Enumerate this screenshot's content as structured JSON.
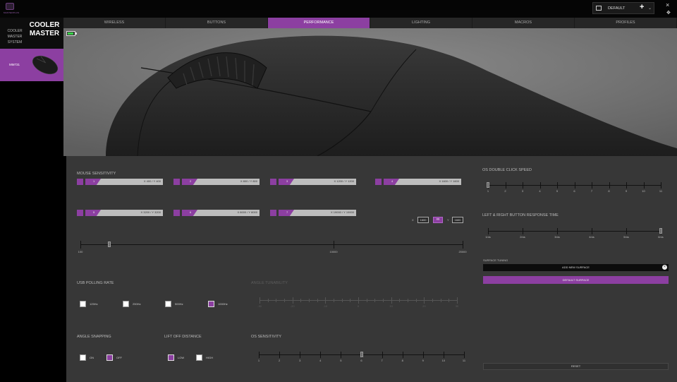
{
  "app": {
    "logo_text": "MASTERPLUS"
  },
  "profile": {
    "name": "DEFAULT",
    "add": "+",
    "chevron": "⌄"
  },
  "window": {
    "close": "×",
    "move": "✥"
  },
  "sidebar": {
    "system_label": "COOLER MASTER SYSTEM",
    "logo_lines": [
      "COOLER",
      "MASTER"
    ],
    "device_name": "MM731"
  },
  "tabs": [
    "WIRELESS",
    "BUTTONS",
    "PERFORMANCE",
    "LIGHTING",
    "MACROS",
    "PROFILES"
  ],
  "active_tab": "PERFORMANCE",
  "battery": {
    "level": 0.7,
    "color": "#39d24a"
  },
  "sensitivity": {
    "title": "MOUSE SENSITIVITY",
    "stages": [
      {
        "n": "1",
        "value": "X 400 / Y 400",
        "enabled": true
      },
      {
        "n": "2",
        "value": "X 800 / Y 800",
        "enabled": true
      },
      {
        "n": "3",
        "value": "X 1200 / Y 1200",
        "enabled": true
      },
      {
        "n": "4",
        "value": "X 1600 / Y 1600",
        "enabled": true,
        "selected": true
      },
      {
        "n": "5",
        "value": "X 3200 / Y 3200",
        "enabled": true
      },
      {
        "n": "6",
        "value": "X 8000 / Y 8000",
        "enabled": true
      },
      {
        "n": "7",
        "value": "X 19000 / Y 19000",
        "enabled": true
      }
    ],
    "x_label": "X",
    "x_value": "1600",
    "y_label": "Y",
    "y_value": "1600",
    "link_icon": "∞",
    "slider": {
      "min": "100",
      "mid": "10000",
      "max": "20000",
      "value": 1600
    }
  },
  "os_double_click": {
    "title": "OS DOUBLE CLICK SPEED",
    "ticks": [
      "1",
      "2",
      "3",
      "4",
      "5",
      "6",
      "7",
      "8",
      "9",
      "10",
      "11"
    ],
    "value": 1
  },
  "response_time": {
    "title": "LEFT & RIGHT BUTTON RESPONSE TIME",
    "ticks": [
      "1ms",
      "2ms",
      "3ms",
      "4ms",
      "5ms",
      "6ms"
    ],
    "value": 6
  },
  "surface": {
    "label": "SURFACE TUNING",
    "add": "ADD NEW SURFACE",
    "default": "DEFAULT SURFACE",
    "close": "×"
  },
  "polling": {
    "title": "USB POLLING RATE",
    "options": [
      {
        "label": "125Hz",
        "on": false
      },
      {
        "label": "250Hz",
        "on": false
      },
      {
        "label": "500Hz",
        "on": false
      },
      {
        "label": "1000Hz",
        "on": true
      }
    ]
  },
  "angle_tunability": {
    "title": "ANGLE TUNABILITY",
    "ticks": [
      "-30",
      "-20",
      "-10",
      "0",
      "10",
      "20",
      "30"
    ]
  },
  "angle_snapping": {
    "title": "ANGLE SNAPPING",
    "options": [
      {
        "label": "ON",
        "on": false
      },
      {
        "label": "OFF",
        "on": true
      }
    ]
  },
  "lift_off": {
    "title": "LIFT OFF DISTANCE",
    "options": [
      {
        "label": "LOW",
        "on": true
      },
      {
        "label": "HIGH",
        "on": false
      }
    ]
  },
  "os_sensitivity": {
    "title": "OS SENSITIVITY",
    "ticks": [
      "1",
      "2",
      "3",
      "4",
      "5",
      "6",
      "7",
      "8",
      "9",
      "10",
      "11"
    ],
    "value": 6
  },
  "reset": "RESET",
  "colors": {
    "accent": "#8c3fa1",
    "panel": "#373737"
  }
}
